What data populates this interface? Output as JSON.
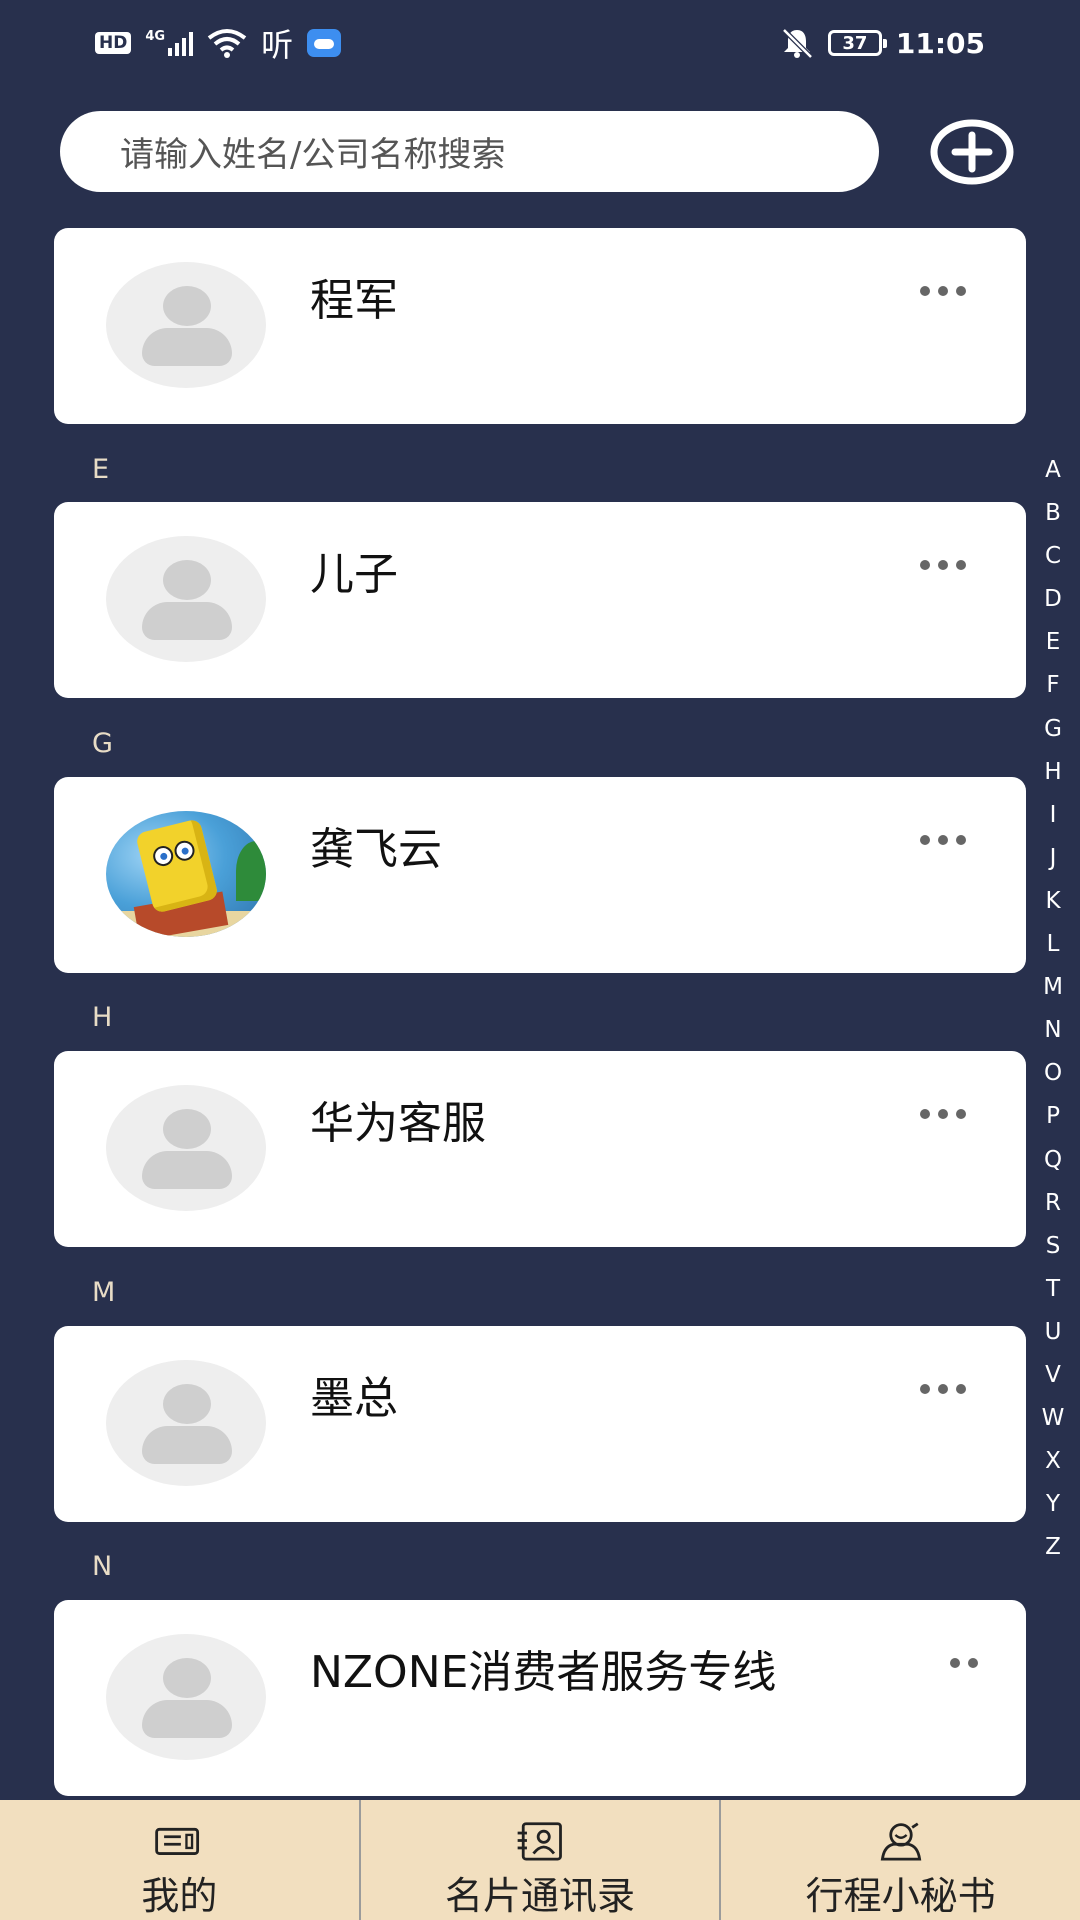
{
  "status_bar": {
    "hd": "HD",
    "network": "4G",
    "listen": "听",
    "battery": "37",
    "time": "11:05"
  },
  "search": {
    "placeholder": "请输入姓名/公司名称搜索"
  },
  "contacts": [
    {
      "section": "",
      "name": "程军",
      "avatar": "default"
    },
    {
      "section": "E",
      "name": "儿子",
      "avatar": "default"
    },
    {
      "section": "G",
      "name": "龚飞云",
      "avatar": "photo"
    },
    {
      "section": "H",
      "name": "华为客服",
      "avatar": "default"
    },
    {
      "section": "M",
      "name": "墨总",
      "avatar": "default"
    },
    {
      "section": "N",
      "name": "NZONE消费者服务专线",
      "avatar": "default"
    }
  ],
  "alphabet": [
    "A",
    "B",
    "C",
    "D",
    "E",
    "F",
    "G",
    "H",
    "I",
    "J",
    "K",
    "L",
    "M",
    "N",
    "O",
    "P",
    "Q",
    "R",
    "S",
    "T",
    "U",
    "V",
    "W",
    "X",
    "Y",
    "Z"
  ],
  "bottom_nav": [
    {
      "label": "我的",
      "icon": "card-icon"
    },
    {
      "label": "名片通讯录",
      "icon": "contact-card-icon"
    },
    {
      "label": "行程小秘书",
      "icon": "assistant-icon"
    }
  ]
}
